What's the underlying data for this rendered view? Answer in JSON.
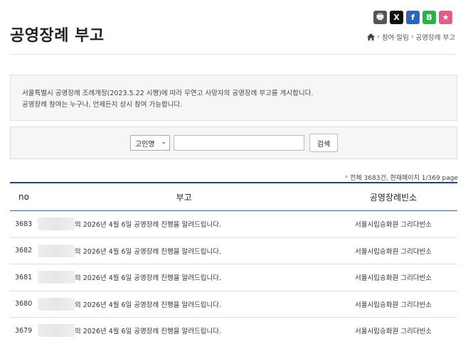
{
  "share": {
    "items": [
      {
        "name": "print",
        "glyph": "🖶",
        "color": "#555555"
      },
      {
        "name": "x",
        "glyph": "X",
        "color": "#111111"
      },
      {
        "name": "facebook",
        "glyph": "f",
        "color": "#2d64bc"
      },
      {
        "name": "band",
        "glyph": "B",
        "color": "#2bb24c"
      },
      {
        "name": "bookmark",
        "glyph": "★",
        "color": "#e85a8a"
      }
    ]
  },
  "header": {
    "title": "공영장례 부고",
    "breadcrumb": [
      "참여·알림",
      "공영장례 부고"
    ]
  },
  "notice": {
    "line1": "서울특별시 공영장례 조례개정(2023.5.22 시행)에 따라 무연고 사망자의 공영장례 부고를 게시합니다.",
    "line2": "공영장례 참여는 누구나, 언제든지 상시 참여 가능합니다."
  },
  "search": {
    "select_value": "고인명",
    "input_value": "",
    "button_label": "검색"
  },
  "total": {
    "text": "전체 3683건, 현재페이지 1/369 page"
  },
  "table": {
    "headers": {
      "no": "no",
      "title": "부고",
      "place": "공영장례빈소"
    },
    "rows": [
      {
        "no": "3683",
        "title": "의 2026년 4월 6일 공영장례 진행을 알려드립니다.",
        "place": "서울시립승화원 그리다빈소"
      },
      {
        "no": "3682",
        "title": "의 2026년 4월 6일 공영장례 진행을 알려드립니다.",
        "place": "서울시립승화원 그리다빈소"
      },
      {
        "no": "3681",
        "title": "의 2026년 4월 6일 공영장례 진행을 알려드립니다.",
        "place": "서울시립승화원 그리다빈소"
      },
      {
        "no": "3680",
        "title": "의 2026년 4월 6일 공영장례 진행을 알려드립니다.",
        "place": "서울시립승화원 그리다빈소"
      },
      {
        "no": "3679",
        "title": "의 2026년 4월 6일 공영장례 진행을 알려드립니다.",
        "place": "서울시립승화원 그리다빈소"
      }
    ]
  }
}
